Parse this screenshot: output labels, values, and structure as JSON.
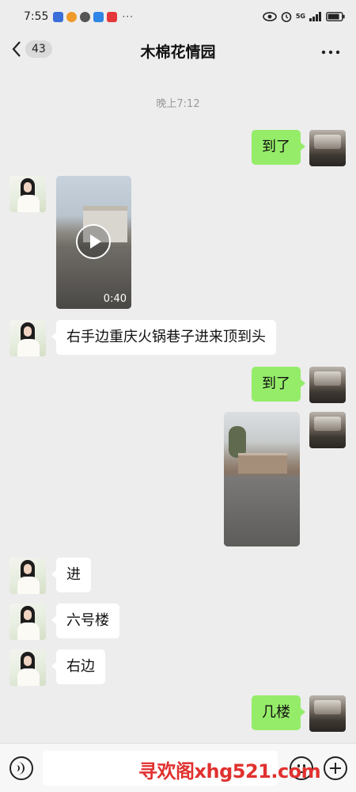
{
  "status_bar": {
    "time": "7:55",
    "notification_icons": [
      "store-app-icon",
      "weibo-icon",
      "wechat-icon",
      "browser-icon",
      "video-app-icon"
    ],
    "more_notifications": "···",
    "network_label": "5G",
    "system_icons": [
      "eye-icon",
      "alarm-icon",
      "signal-icon",
      "battery-icon"
    ]
  },
  "header": {
    "unread_count": "43",
    "title": "木棉花情园"
  },
  "messages": {
    "timestamp": "晚上7:12",
    "m1": "到了",
    "m2_duration": "0:40",
    "m3": "右手边重庆火锅巷子进来顶到头",
    "m4": "到了",
    "m6": "进",
    "m7": "六号楼",
    "m8": "右边",
    "m9": "几楼"
  },
  "input_bar": {
    "value": "",
    "watermark": "寻欢阁xhg521.com"
  }
}
